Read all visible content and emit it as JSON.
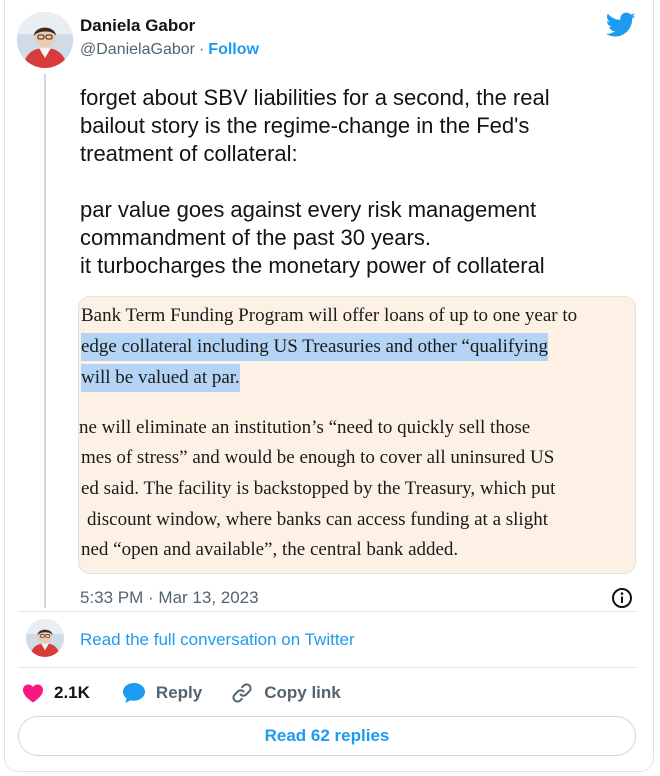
{
  "author": {
    "name": "Daniela Gabor",
    "handle": "@DanielaGabor",
    "separator": "·",
    "follow_label": "Follow"
  },
  "icons": {
    "brand": "twitter-bird-icon",
    "info": "info-icon",
    "like": "heart-icon",
    "reply": "speech-bubble-icon",
    "copy": "link-icon"
  },
  "colors": {
    "accent": "#1d9bf0",
    "like": "#f91880",
    "media_background": "#fdf1e6",
    "highlight": "#b3d4f5"
  },
  "tweet": {
    "text_lines": [
      "forget about SBV liabilities for a second, the real",
      "bailout story is  the regime-change in the Fed's",
      "treatment of collateral:",
      "par value goes against every risk management",
      "commandment of the past 30 years.",
      "it turbocharges the monetary power of collateral"
    ],
    "media_lines": [
      "Bank Term Funding Program will offer loans of up to one year to",
      "edge collateral including US Treasuries and other “qualifying",
      "will be valued at par.",
      "ne will eliminate an institution’s “need to quickly sell those",
      "mes of stress” and would be enough to cover all uninsured US",
      "ed said. The facility is backstopped by the Treasury, which put",
      "discount window, where banks can access funding at a slight",
      "ned “open and available”, the central bank added."
    ],
    "timestamp": "5:33 PM · Mar 13, 2023"
  },
  "conversation_link": "Read the full conversation on Twitter",
  "actions": {
    "likes": "2.1K",
    "reply_label": "Reply",
    "copy_label": "Copy link"
  },
  "read_replies_label": "Read 62 replies"
}
